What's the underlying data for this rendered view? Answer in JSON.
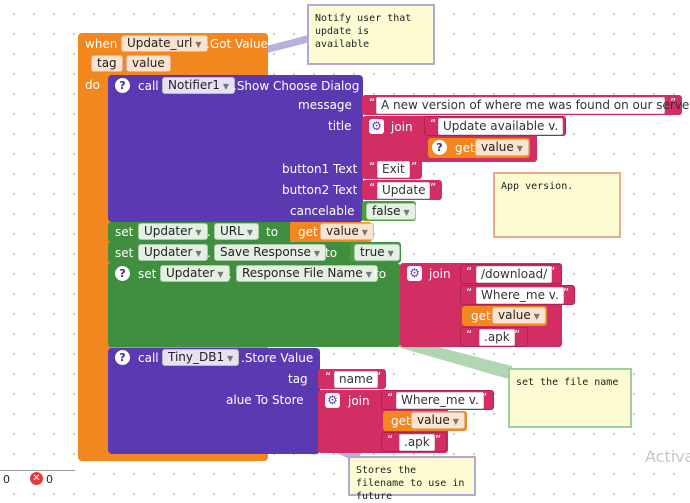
{
  "event": {
    "when": "when",
    "component": "Update_url",
    "event_name": ".Got Value",
    "params": [
      "tag",
      "value"
    ],
    "do": "do"
  },
  "dialog": {
    "call": "call",
    "component": "Notifier1",
    "method": ".Show Choose Dialog",
    "message_label": "message",
    "message_value": "A new version of where me was found on our serve...",
    "title_label": "title",
    "join": "join",
    "title_text": "Update available v.",
    "get": "get",
    "get_var": "value",
    "button1_label": "button1 Text",
    "button1_value": "Exit",
    "button2_label": "button2 Text",
    "button2_value": "Update",
    "cancelable_label": "cancelable",
    "cancelable_value": "false"
  },
  "set_url": {
    "set": "set",
    "component": "Updater",
    "property": "URL",
    "to": "to",
    "get": "get",
    "var": "value"
  },
  "set_save": {
    "set": "set",
    "component": "Updater",
    "property": "Save Response",
    "to": "to",
    "value": "true"
  },
  "set_resp": {
    "set": "set",
    "component": "Updater",
    "property": "Response File Name",
    "to": "to",
    "join": "join",
    "part1": "/download/",
    "part2": "Where_me v.",
    "get": "get",
    "var": "value",
    "part4": ".apk"
  },
  "store": {
    "call": "call",
    "component": "Tiny_DB1",
    "method": ".Store Value",
    "tag_label": "tag",
    "tag_value": "name",
    "value_label": "valueToStore",
    "value_label_visible": "alue To Store",
    "join": "join",
    "part1": "Where_me v.",
    "get": "get",
    "var": "value",
    "part3": ".apk"
  },
  "comments": {
    "notify": "Notify user that update is available",
    "version": "App version.",
    "filename": "set the file name",
    "store": "Stores the filename to use in future"
  },
  "status": {
    "warnings": "0",
    "errors": "0"
  },
  "watermark": "Activa"
}
